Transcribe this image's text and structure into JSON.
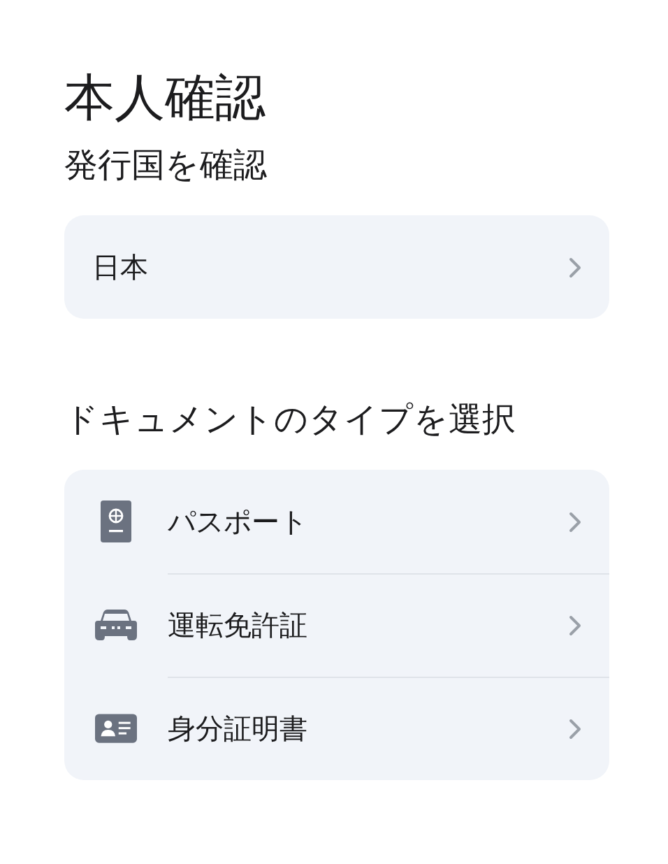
{
  "title": "本人確認",
  "country_section": {
    "heading": "発行国を確認",
    "country": "日本"
  },
  "document_section": {
    "heading": "ドキュメントのタイプを選択",
    "items": [
      {
        "kind": "passport",
        "label": "パスポート"
      },
      {
        "kind": "car",
        "label": "運転免許証"
      },
      {
        "kind": "idcard",
        "label": "身分証明書"
      }
    ]
  }
}
